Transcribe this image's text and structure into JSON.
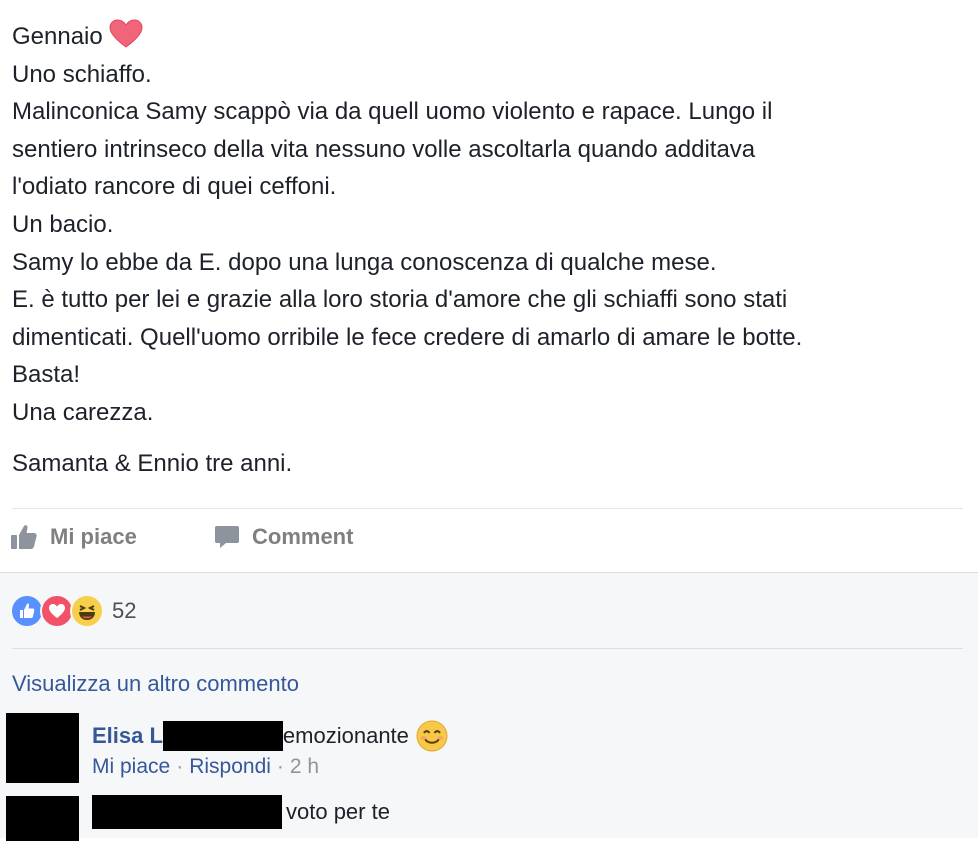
{
  "post": {
    "lines": [
      "Gennaio",
      "Uno schiaffo.",
      "Malinconica Samy scappò via da quell uomo violento e rapace. Lungo il",
      "sentiero intrinseco della vita nessuno volle ascoltarla quando additava",
      "l'odiato rancore di quei ceffoni.",
      "Un bacio.",
      "Samy lo ebbe da E. dopo una lunga conoscenza di qualche mese.",
      "E. è tutto per lei e grazie alla loro storia d'amore che gli schiaffi sono stati",
      "dimenticati. Quell'uomo orribile le fece credere di amarlo di amare le botte.",
      "Basta!",
      "Una carezza.",
      "Samanta & Ennio tre anni."
    ]
  },
  "actions": {
    "like_label": "Mi piace",
    "comment_label": "Comment"
  },
  "reactions": {
    "types": [
      "like",
      "love",
      "haha"
    ],
    "count": "52"
  },
  "comments": {
    "more_label": "Visualizza un altro commento",
    "items": [
      {
        "author": "Elisa L",
        "text": "emozionante",
        "like_label": "Mi piace",
        "separator": "·",
        "reply_label": "Rispondi",
        "time": "2 h"
      },
      {
        "author": "",
        "text": "voto per te"
      }
    ]
  },
  "colors": {
    "link": "#365899",
    "action_gray": "#7f7f7f",
    "like_blue": "#5890ff",
    "love_red": "#f25268",
    "haha_yellow": "#f7d04b"
  },
  "icons": [
    "heart-emoji-icon",
    "thumbs-up-icon",
    "comment-bubble-icon",
    "like-reaction-icon",
    "love-reaction-icon",
    "haha-reaction-icon",
    "smile-emoji-icon"
  ]
}
